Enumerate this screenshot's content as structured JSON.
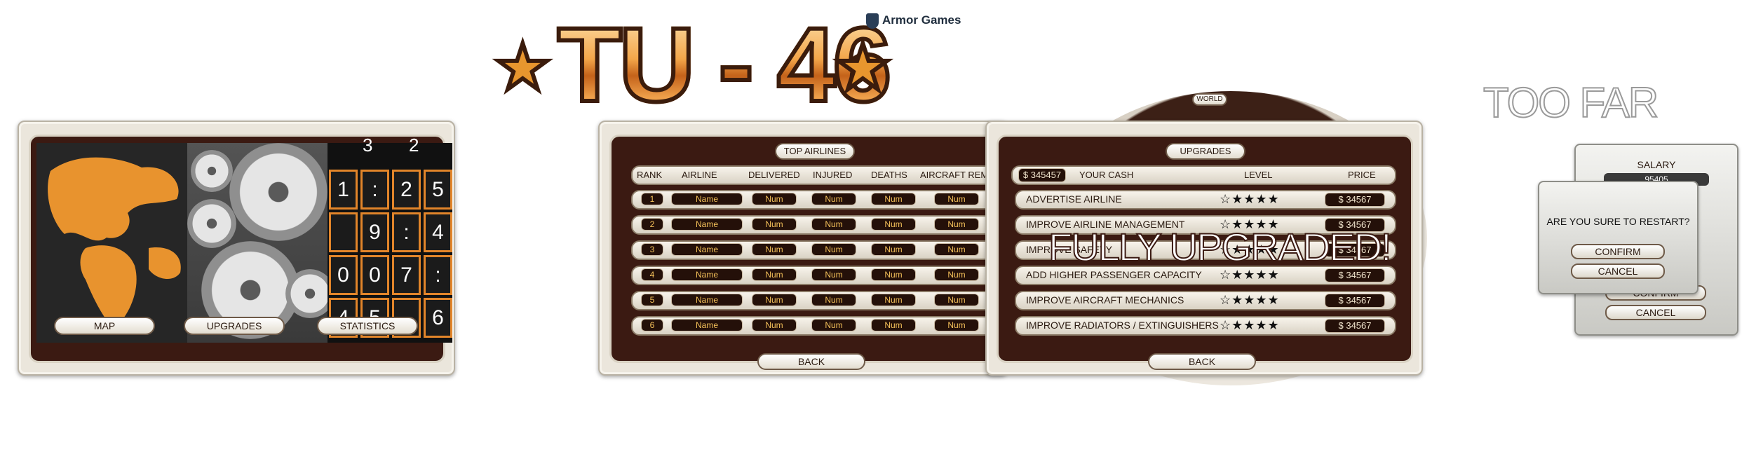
{
  "title": {
    "text": "TU - 46",
    "star": "★"
  },
  "armor_games": {
    "label": "Armor Games",
    "icon": "shield-icon"
  },
  "main_menu": {
    "buttons": [
      "MAP",
      "UPGRADES",
      "STATISTICS"
    ],
    "statistics_digits": [
      "1",
      ":",
      "2",
      "5",
      "",
      "9",
      ":",
      "4",
      "0",
      "0",
      "7",
      ":",
      "4",
      "5",
      "",
      "6"
    ],
    "top_digits": [
      "3",
      "2"
    ]
  },
  "top_airlines": {
    "title": "TOP AIRLINES",
    "headers": [
      "RANK",
      "AIRLINE",
      "DELIVERED",
      "INJURED",
      "DEATHS",
      "AIRCRAFT REMAI"
    ],
    "rows": [
      {
        "rank": "1",
        "airline": "Name",
        "delivered": "Num",
        "injured": "Num",
        "deaths": "Num",
        "aircraft": "Num"
      },
      {
        "rank": "2",
        "airline": "Name",
        "delivered": "Num",
        "injured": "Num",
        "deaths": "Num",
        "aircraft": "Num"
      },
      {
        "rank": "3",
        "airline": "Name",
        "delivered": "Num",
        "injured": "Num",
        "deaths": "Num",
        "aircraft": "Num"
      },
      {
        "rank": "4",
        "airline": "Name",
        "delivered": "Num",
        "injured": "Num",
        "deaths": "Num",
        "aircraft": "Num"
      },
      {
        "rank": "5",
        "airline": "Name",
        "delivered": "Num",
        "injured": "Num",
        "deaths": "Num",
        "aircraft": "Num"
      },
      {
        "rank": "6",
        "airline": "Name",
        "delivered": "Num",
        "injured": "Num",
        "deaths": "Num",
        "aircraft": "Num"
      }
    ],
    "back_label": "BACK"
  },
  "upgrades": {
    "title": "UPGRADES",
    "world_label": "WORLD",
    "cash": "$ 345457",
    "headers": [
      "YOUR CASH",
      "LEVEL",
      "PRICE"
    ],
    "items": [
      {
        "label": "ADVERTISE AIRLINE",
        "stars": "☆★★★★",
        "price": "$ 34567"
      },
      {
        "label": "IMPROVE AIRLINE MANAGEMENT",
        "stars": "☆★★★★",
        "price": "$ 34567"
      },
      {
        "label": "IMPROVE SAFETY",
        "stars": "☆★★★★",
        "price": "$ 34567"
      },
      {
        "label": "ADD HIGHER PASSENGER CAPACITY",
        "stars": "☆★★★★",
        "price": "$ 34567"
      },
      {
        "label": "IMPROVE AIRCRAFT MECHANICS",
        "stars": "☆★★★★",
        "price": "$ 34567"
      },
      {
        "label": "IMPROVE RADIATORS / EXTINGUISHERS",
        "stars": "☆★★★★",
        "price": "$ 34567"
      }
    ],
    "overlay": "FULLY UPGRADED!",
    "back_label": "BACK"
  },
  "too_far": {
    "text": "TOO FAR"
  },
  "salary_dialog": {
    "title": "SALARY",
    "value": "95405",
    "confirm": "CONFIRM",
    "cancel": "CANCEL"
  },
  "restart_dialog": {
    "title": "ARE YOU SURE TO RESTART?",
    "confirm": "CONFIRM",
    "cancel": "CANCEL"
  },
  "colors": {
    "accent": "#e2852a",
    "panel_dark": "#3b1a12",
    "gold_text": "#f4c15a"
  }
}
